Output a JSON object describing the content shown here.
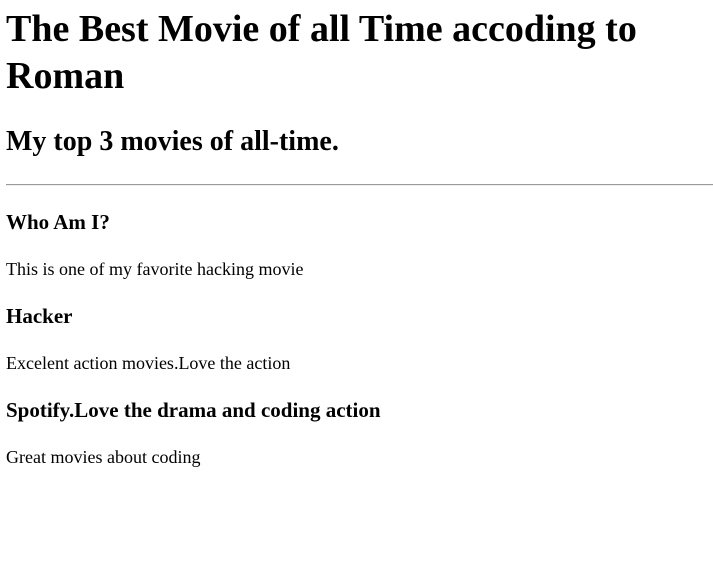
{
  "page": {
    "title": "The Best Movie of all Time accoding to Roman",
    "subtitle": "My top 3 movies of all-time."
  },
  "movies": [
    {
      "heading": "Who Am I?",
      "description": "This is one of my favorite hacking movie"
    },
    {
      "heading": "Hacker",
      "description": "Excelent action movies.Love the action"
    },
    {
      "heading": "Spotify.Love the drama and coding action",
      "description": "Great movies about coding"
    }
  ]
}
